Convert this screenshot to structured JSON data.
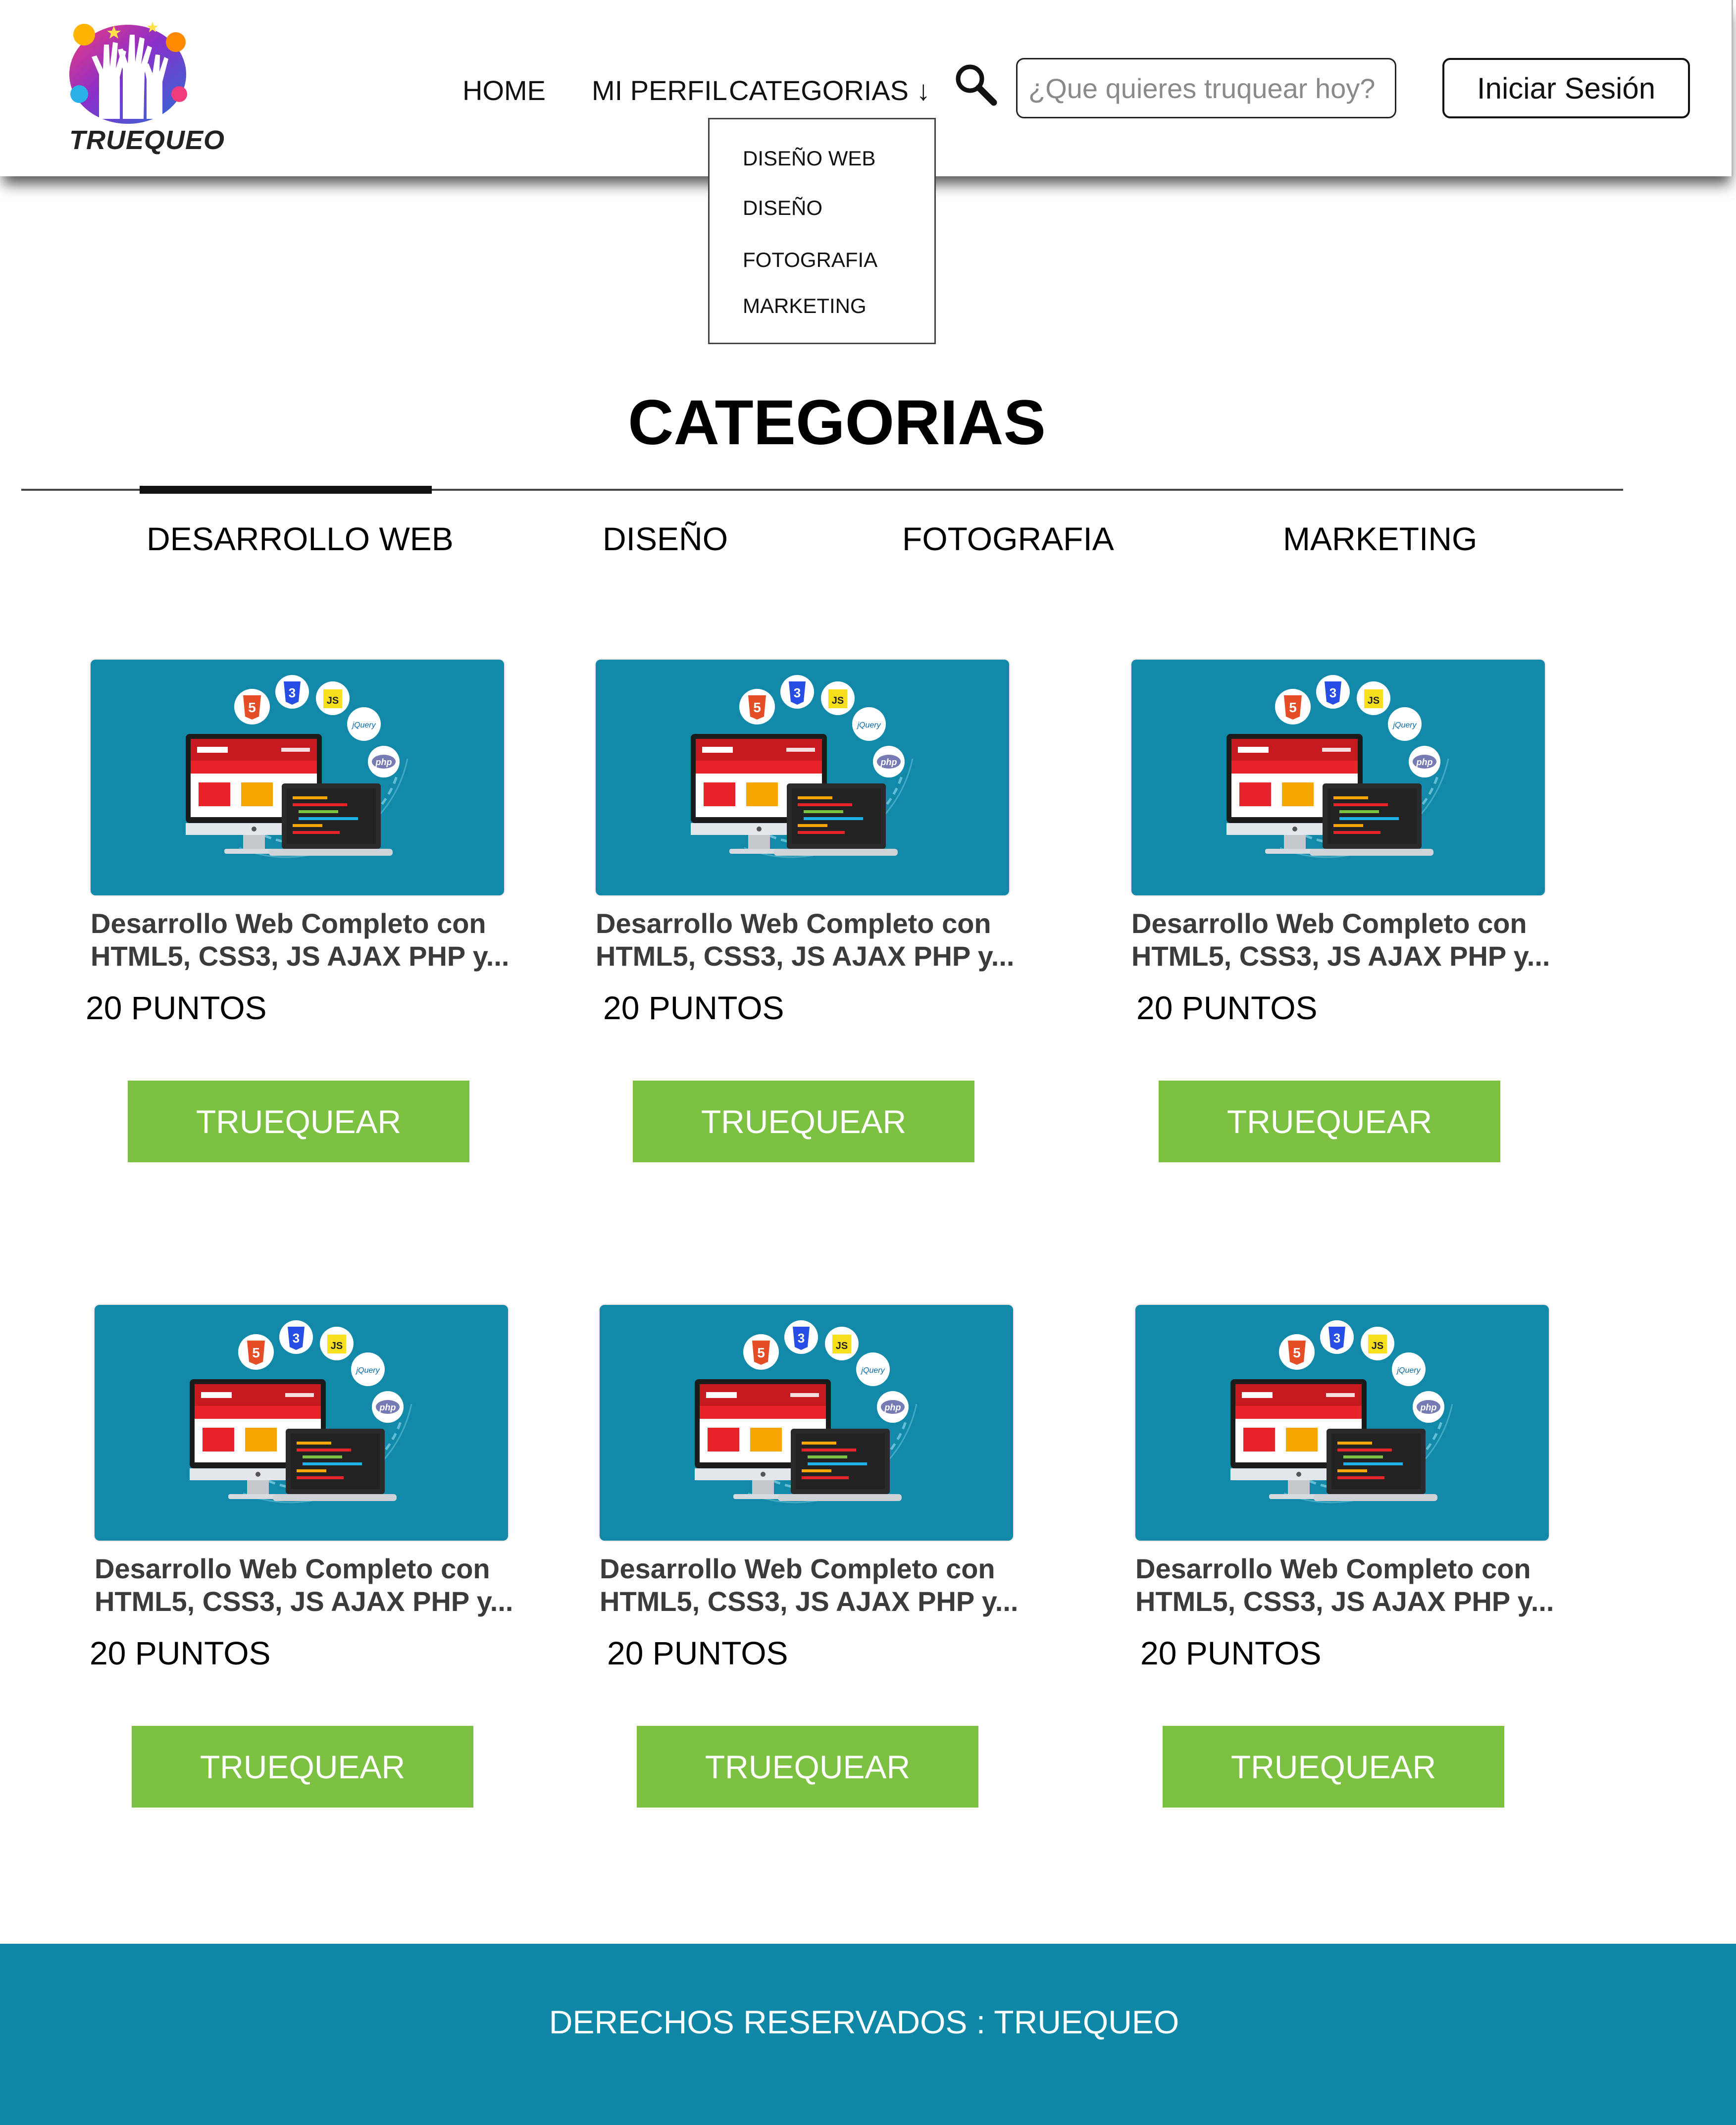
{
  "brand": {
    "name": "TRUEQUEO",
    "logo_icon": "raised-hands-logo-icon"
  },
  "nav": {
    "home": "HOME",
    "profile": "MI PERFIL",
    "categories": "CATEGORIAS ↓"
  },
  "search": {
    "icon": "search-icon",
    "placeholder": "¿Que quieres truquear hoy?"
  },
  "login_label": "Iniciar Sesión",
  "dropdown": {
    "items": [
      "DISEÑO WEB",
      "DISEÑO",
      "FOTOGRAFIA",
      "MARKETING"
    ]
  },
  "page_title": "CATEGORIAS",
  "tabs": [
    {
      "label": "DESARROLLO WEB",
      "active": true
    },
    {
      "label": "DISEÑO",
      "active": false
    },
    {
      "label": "FOTOGRAFIA",
      "active": false
    },
    {
      "label": "MARKETING",
      "active": false
    }
  ],
  "cards": [
    {
      "title_line1": "Desarrollo Web Completo con",
      "title_line2": "HTML5, CSS3, JS AJAX PHP y...",
      "points": "20 PUNTOS",
      "button": "TRUEQUEAR",
      "image": "web-development-illustration"
    },
    {
      "title_line1": "Desarrollo Web Completo con",
      "title_line2": "HTML5, CSS3, JS AJAX PHP y...",
      "points": "20 PUNTOS",
      "button": "TRUEQUEAR",
      "image": "web-development-illustration"
    },
    {
      "title_line1": "Desarrollo Web Completo con",
      "title_line2": "HTML5, CSS3, JS AJAX PHP y...",
      "points": "20 PUNTOS",
      "button": "TRUEQUEAR",
      "image": "web-development-illustration"
    },
    {
      "title_line1": "Desarrollo Web Completo con",
      "title_line2": "HTML5, CSS3, JS AJAX PHP y...",
      "points": "20 PUNTOS",
      "button": "TRUEQUEAR",
      "image": "web-development-illustration"
    },
    {
      "title_line1": "Desarrollo Web Completo con",
      "title_line2": "HTML5, CSS3, JS AJAX PHP y...",
      "points": "20 PUNTOS",
      "button": "TRUEQUEAR",
      "image": "web-development-illustration"
    },
    {
      "title_line1": "Desarrollo Web Completo con",
      "title_line2": "HTML5, CSS3, JS AJAX PHP y...",
      "points": "20 PUNTOS",
      "button": "TRUEQUEAR",
      "image": "web-development-illustration"
    }
  ],
  "card_image_labels": {
    "html": "5",
    "css": "3",
    "js": "JS",
    "jquery": "jQuery",
    "php": "php"
  },
  "footer": "DERECHOS RESERVADOS : TRUEQUEO",
  "colors": {
    "accent_green": "#7dc142",
    "footer_teal": "#0f88a8",
    "card_image_bg": "#1289a8"
  }
}
